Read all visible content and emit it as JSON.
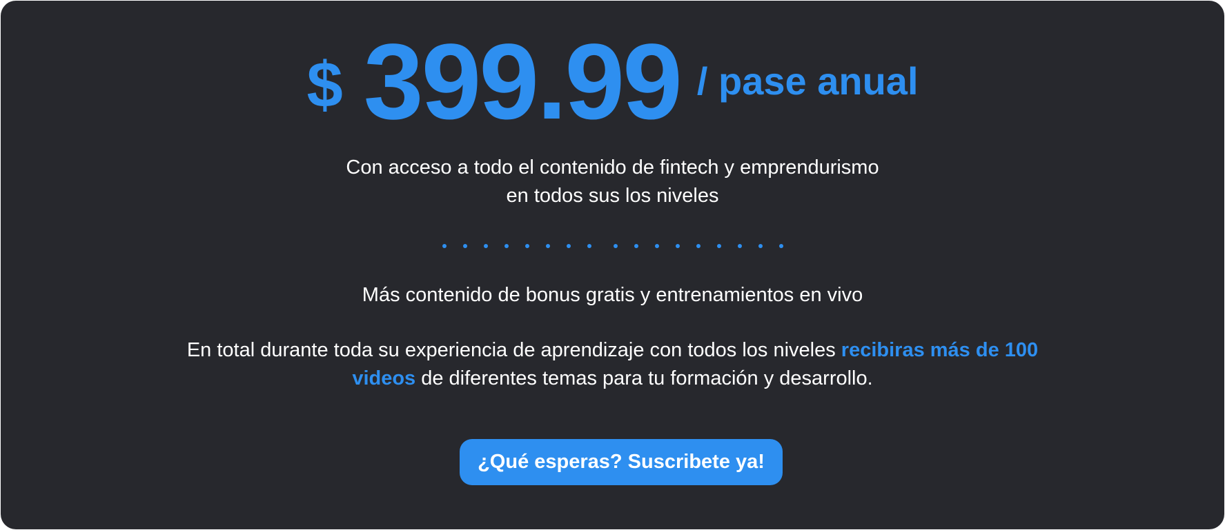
{
  "pricing": {
    "currency": "$",
    "amount": "399.99",
    "period": "/ pase anual",
    "description_line_1": "Con acceso a todo el contenido de fintech y emprendurismo",
    "description_line_2": "en todos sus los niveles",
    "bonus_text": "Más contenido de bonus gratis y entrenamientos en vivo",
    "total_text_prefix": "En total durante toda su experiencia de aprendizaje con todos los niveles ",
    "total_text_highlight": "recibiras más de 100 videos",
    "total_text_suffix": " de diferentes temas para tu formación y desarrollo.",
    "cta_label": "¿Qué esperas? Suscribete ya!"
  },
  "colors": {
    "card_background": "#27282d",
    "accent": "#2e8ff0",
    "text": "#ffffff"
  }
}
